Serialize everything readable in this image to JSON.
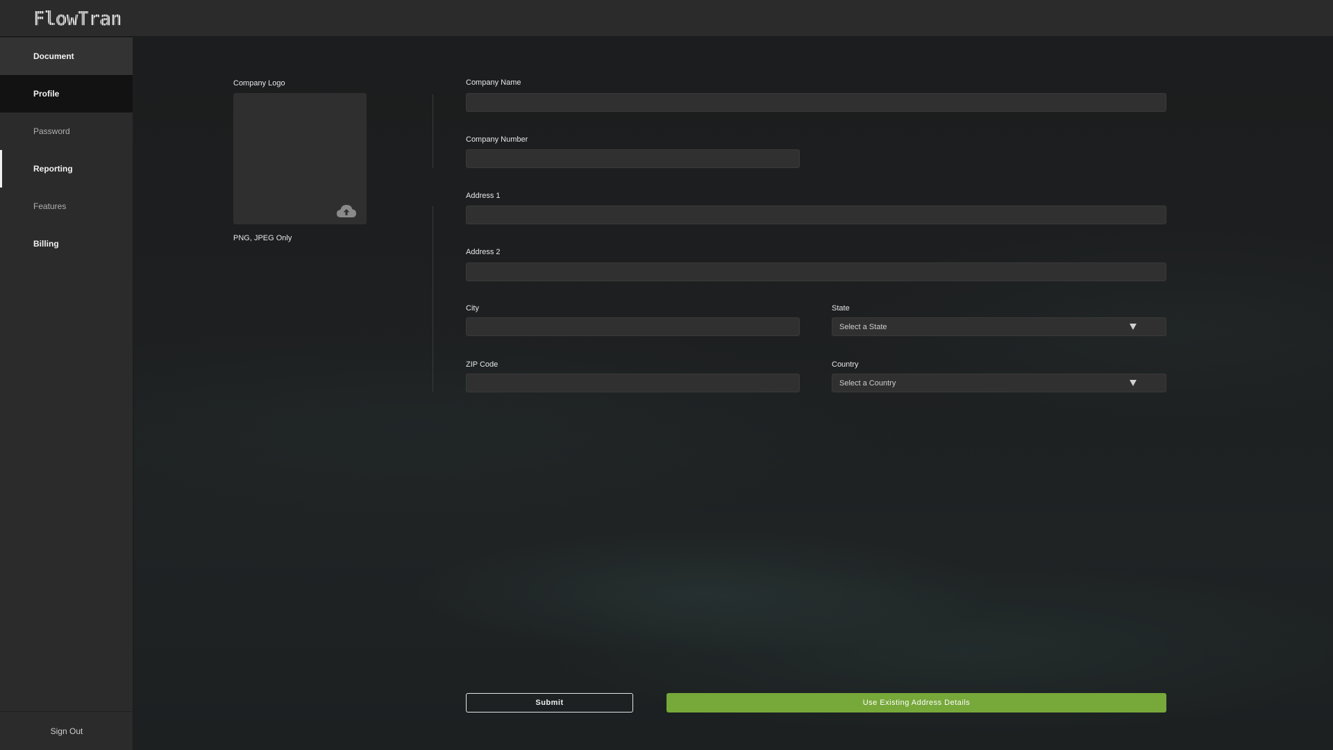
{
  "app": {
    "logo": "FlowTran"
  },
  "sidebar": {
    "items": [
      {
        "label": "Document"
      },
      {
        "label": "Profile"
      },
      {
        "label": "Password"
      },
      {
        "label": "Reporting"
      },
      {
        "label": "Features"
      },
      {
        "label": "Billing"
      }
    ],
    "signout_label": "Sign Out"
  },
  "form": {
    "logo_label": "Company Logo",
    "logo_hint": "PNG, JPEG Only",
    "company_name_label": "Company Name",
    "company_name_value": "",
    "company_number_label": "Company Number",
    "company_number_value": "",
    "address1_label": "Address 1",
    "address1_value": "",
    "address2_label": "Address 2",
    "address2_value": "",
    "city_label": "City",
    "city_value": "",
    "state_label": "State",
    "state_placeholder": "Select a State",
    "zip_label": "ZIP Code",
    "zip_value": "",
    "country_label": "Country",
    "country_placeholder": "Select a Country"
  },
  "actions": {
    "submit_label": "Submit",
    "existing_label": "Use Existing Address Details"
  },
  "icons": {
    "upload": "cloud-upload-icon",
    "dropdown": "caret-down-icon"
  },
  "colors": {
    "accent": "#77a83a",
    "sidebar_bg": "#2b2b2b",
    "active_bg": "#121212"
  }
}
